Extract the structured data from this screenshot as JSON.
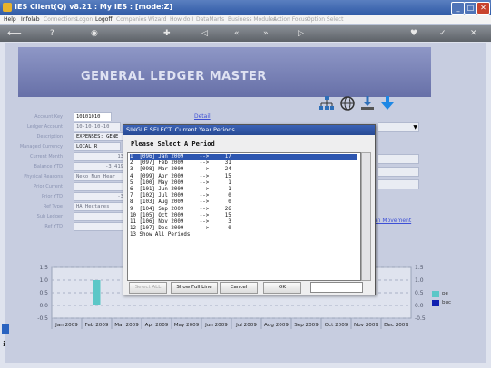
{
  "window": {
    "title": "IES Client(Q) v8.21 : My IES :      [mode:Z]",
    "controls": [
      "_",
      "□",
      "✕"
    ]
  },
  "menu": {
    "items": [
      {
        "label": "Help",
        "enabled": true
      },
      {
        "label": "Infolab",
        "enabled": true
      },
      {
        "label": "Connections",
        "enabled": false
      },
      {
        "label": "Logon",
        "enabled": false
      },
      {
        "label": "Logoff",
        "enabled": true
      },
      {
        "label": "Companies",
        "enabled": false
      },
      {
        "label": "Wizard",
        "enabled": false
      },
      {
        "label": "How do I",
        "enabled": false
      },
      {
        "label": "DataMarts",
        "enabled": false
      },
      {
        "label": "Business Modules",
        "enabled": false
      },
      {
        "label": "Action Focus",
        "enabled": false
      },
      {
        "label": "Option Select",
        "enabled": false
      }
    ]
  },
  "toolbar": {
    "icons": [
      "back-arrow-icon",
      "help-icon",
      "record-icon",
      "new-icon",
      "prev-icon",
      "first-icon",
      "last-icon",
      "next-icon",
      "delete-icon",
      "confirm-icon",
      "close-icon"
    ]
  },
  "page": {
    "title": "GENERAL LEDGER MASTER"
  },
  "form": {
    "labels": [
      "Account Key",
      "Ledger Account",
      "Description",
      "Managed Currency",
      "Current Month",
      "Balance YTD",
      "Physical Reasons",
      "Prior Current",
      "Prior YTD",
      "Ref Type",
      "Sub Ledger",
      "Ref YTD"
    ],
    "values": [
      "10101010",
      "10-10-10-10",
      "EXPENSES: GENE",
      "LOCAL R",
      "13",
      "-3,419",
      "Neko Nun Hear",
      "",
      "-3",
      "HA Hectares",
      "",
      ""
    ],
    "detail_link": "Detail",
    "movement_link": "an Movement"
  },
  "chart_data": {
    "type": "bar",
    "categories": [
      "Jan 2009",
      "Feb 2009",
      "Mar 2009",
      "Apr 2009",
      "May 2009",
      "Jun 2009",
      "Jul 2009",
      "Aug 2009",
      "Sep 2009",
      "Oct 2009",
      "Nov 2009",
      "Dec 2009"
    ],
    "series": [
      {
        "name": "pe",
        "values": [
          0,
          1.0,
          0,
          0,
          0,
          0,
          0,
          0,
          0,
          0,
          0,
          0
        ]
      },
      {
        "name": "buc",
        "values": [
          0,
          0,
          0,
          0,
          0,
          0,
          0,
          0,
          0,
          0,
          0,
          0
        ]
      }
    ],
    "ylim": [
      -0.5,
      1.5
    ],
    "yticks": [
      "1.5",
      "1.0",
      "0.5",
      "0.0",
      "-0.5"
    ],
    "yticks_right": [
      "1.5",
      "1.0",
      "0.5",
      "0.0",
      "-0.5"
    ],
    "colors": {
      "pe": "#5cc7c7",
      "buc": "#1020b0"
    },
    "grid": true,
    "legend": "right"
  },
  "dialog": {
    "title": "SINGLE SELECT: Current Year Periods",
    "prompt": "Please Select A Period",
    "rows": [
      "1  [096] Jan 2009     -->     17",
      "2  [097] Feb 2009     -->     31",
      "3  [098] Mar 2009     -->     24",
      "4  [099] Apr 2009     -->     15",
      "5  [100] May 2009     -->      1",
      "6  [101] Jun 2009     -->      1",
      "7  [102] Jul 2009     -->      0",
      "8  [103] Aug 2009     -->      0",
      "9  [104] Sep 2009     -->     26",
      "10 [105] Oct 2009     -->     15",
      "11 [106] Nov 2009     -->      3",
      "12 [107] Dec 2009     -->      0",
      "13 Show All Periods"
    ],
    "selected_index": 0,
    "buttons": {
      "select_all": "Select ALL",
      "show_full_line": "Show Full Line",
      "cancel": "Cancel",
      "ok": "OK"
    }
  },
  "colors": {
    "title_bar": "#2f5aa6",
    "selection": "#2d56b0",
    "header_band": "#6770a8"
  }
}
